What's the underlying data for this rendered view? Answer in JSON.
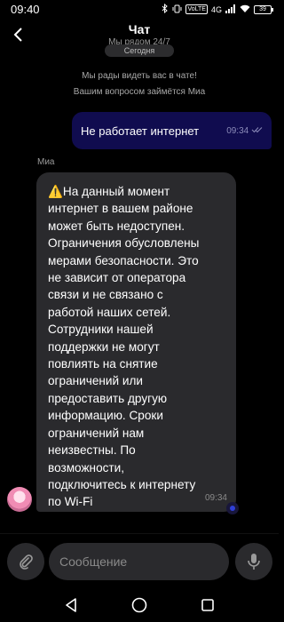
{
  "status_bar": {
    "time": "09:40",
    "network": "VoLTE",
    "signal": "4G",
    "battery": "39"
  },
  "header": {
    "title": "Чат",
    "subtitle": "Мы рядом 24/7"
  },
  "chat": {
    "date_label": "Сегодня",
    "system_messages": [
      "Мы рады видеть вас в чате!",
      "Вашим вопросом займётся Миа"
    ],
    "outgoing": {
      "text": "Не работает интернет",
      "time": "09:34",
      "status_icon": "double-check-icon"
    },
    "incoming": {
      "sender": "Миа",
      "text": "⚠️На данный момент\nинтернет в вашем районе\nможет быть недоступен.\nОграничения обусловлены\nмерами безопасности. Это\nне зависит от оператора\nсвязи и не связано с\nработой наших сетей.\nСотрудники нашей\nподдержки не могут\nповлиять на снятие\nограничений или\nпредоставить другую\nинформацию. Сроки\nограничений нам\nнеизвестны. По\nвозможности,\nподключитесь к интернету\nпо Wi-Fi",
      "time": "09:34"
    }
  },
  "composer": {
    "placeholder": "Сообщение"
  },
  "colors": {
    "background": "#000000",
    "outgoing_bubble": "#100c4f",
    "incoming_bubble": "#2a2a2d",
    "accent_dot": "#2f40d8"
  }
}
